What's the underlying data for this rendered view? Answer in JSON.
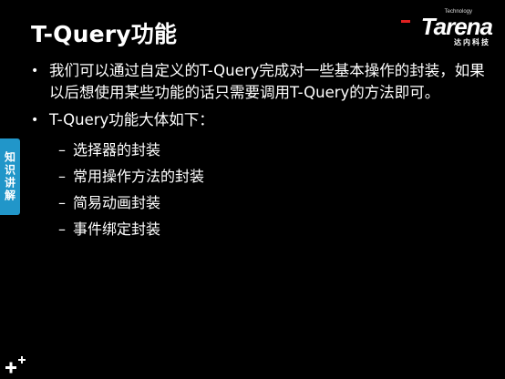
{
  "slide": {
    "title": "T-Query功能",
    "logo": {
      "tech": "Technology",
      "brand": "Tarena",
      "cn": "达内科技"
    },
    "side_tab": "知识讲解",
    "bullets": [
      "我们可以通过自定义的T-Query完成对一些基本操作的封装，如果以后想使用某些功能的话只需要调用T-Query的方法即可。",
      "T-Query功能大体如下："
    ],
    "sub_items": [
      "选择器的封装",
      "常用操作方法的封装",
      "简易动画封装",
      "事件绑定封装"
    ],
    "colors": {
      "background": "#000000",
      "side_tab": "#2196c9",
      "logo_accent": "#e02020"
    }
  }
}
